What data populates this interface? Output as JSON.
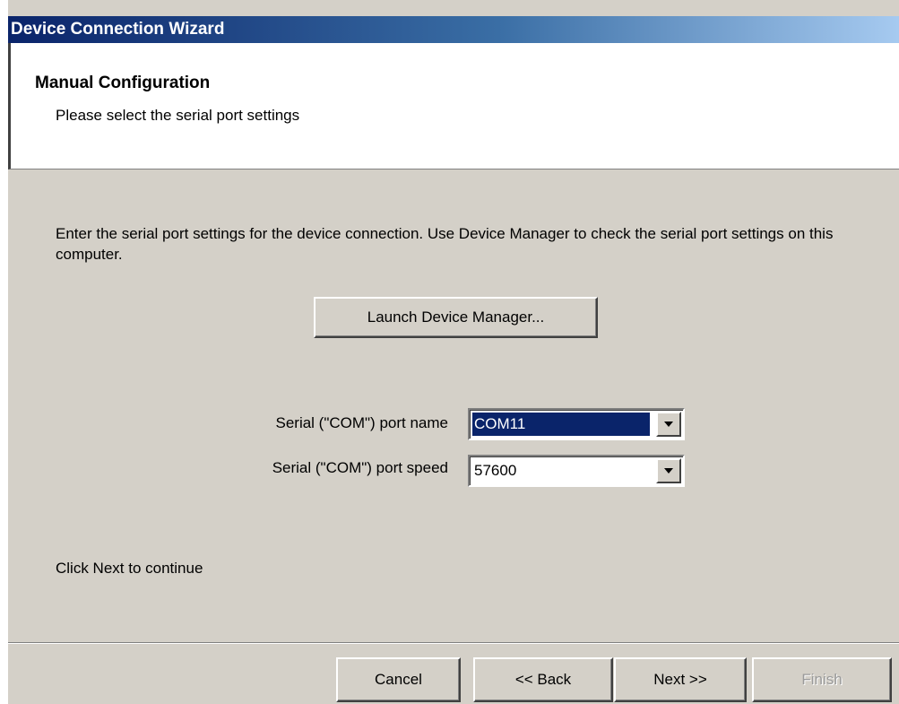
{
  "window": {
    "title": "Device Connection Wizard"
  },
  "header": {
    "title": "Manual Configuration",
    "subtitle": "Please select the serial port settings"
  },
  "main": {
    "instructions": "Enter the serial port settings for the device connection. Use Device Manager to check the serial port settings on this computer.",
    "launch_button_label": "Launch Device Manager...",
    "port_name": {
      "label": "Serial (\"COM\") port name",
      "value": "COM11",
      "selected": true,
      "icon": "chevron-down-icon"
    },
    "port_speed": {
      "label": "Serial (\"COM\") port speed",
      "value": "57600",
      "icon": "chevron-down-icon"
    },
    "continue_text": "Click Next to continue"
  },
  "footer": {
    "cancel_label": "Cancel",
    "back_label": "<< Back",
    "next_label": "Next >>",
    "finish_label": "Finish",
    "finish_enabled": false
  },
  "colors": {
    "title_gradient_start": "#0a246a",
    "title_gradient_end": "#a6caf0",
    "dialog_background": "#d4d0c8",
    "selection_background": "#0a246a",
    "disabled_text": "#9a9a9a"
  }
}
